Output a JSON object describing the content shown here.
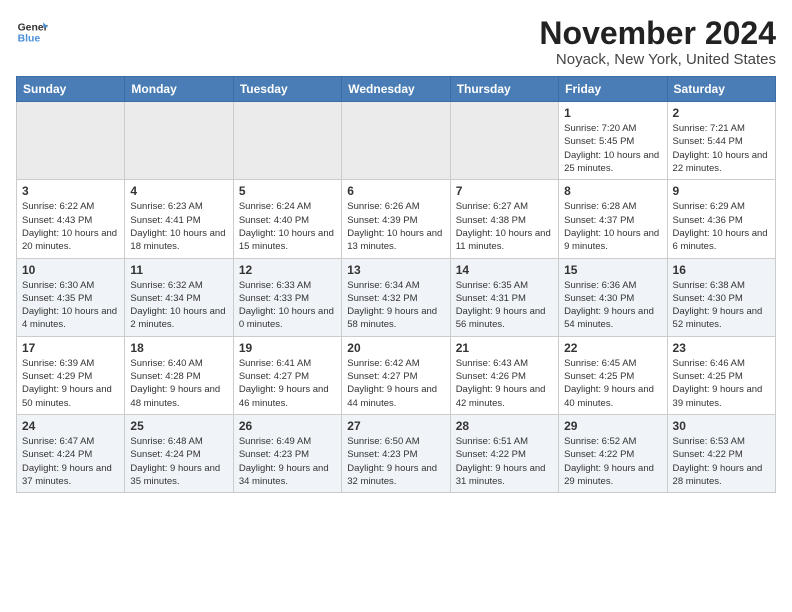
{
  "header": {
    "logo_line1": "General",
    "logo_line2": "Blue",
    "month_title": "November 2024",
    "location": "Noyack, New York, United States"
  },
  "days_of_week": [
    "Sunday",
    "Monday",
    "Tuesday",
    "Wednesday",
    "Thursday",
    "Friday",
    "Saturday"
  ],
  "weeks": [
    [
      {
        "empty": true
      },
      {
        "empty": true
      },
      {
        "empty": true
      },
      {
        "empty": true
      },
      {
        "empty": true
      },
      {
        "day": "1",
        "sunrise": "Sunrise: 7:20 AM",
        "sunset": "Sunset: 5:45 PM",
        "daylight": "Daylight: 10 hours and 25 minutes."
      },
      {
        "day": "2",
        "sunrise": "Sunrise: 7:21 AM",
        "sunset": "Sunset: 5:44 PM",
        "daylight": "Daylight: 10 hours and 22 minutes."
      }
    ],
    [
      {
        "day": "3",
        "sunrise": "Sunrise: 6:22 AM",
        "sunset": "Sunset: 4:43 PM",
        "daylight": "Daylight: 10 hours and 20 minutes."
      },
      {
        "day": "4",
        "sunrise": "Sunrise: 6:23 AM",
        "sunset": "Sunset: 4:41 PM",
        "daylight": "Daylight: 10 hours and 18 minutes."
      },
      {
        "day": "5",
        "sunrise": "Sunrise: 6:24 AM",
        "sunset": "Sunset: 4:40 PM",
        "daylight": "Daylight: 10 hours and 15 minutes."
      },
      {
        "day": "6",
        "sunrise": "Sunrise: 6:26 AM",
        "sunset": "Sunset: 4:39 PM",
        "daylight": "Daylight: 10 hours and 13 minutes."
      },
      {
        "day": "7",
        "sunrise": "Sunrise: 6:27 AM",
        "sunset": "Sunset: 4:38 PM",
        "daylight": "Daylight: 10 hours and 11 minutes."
      },
      {
        "day": "8",
        "sunrise": "Sunrise: 6:28 AM",
        "sunset": "Sunset: 4:37 PM",
        "daylight": "Daylight: 10 hours and 9 minutes."
      },
      {
        "day": "9",
        "sunrise": "Sunrise: 6:29 AM",
        "sunset": "Sunset: 4:36 PM",
        "daylight": "Daylight: 10 hours and 6 minutes."
      }
    ],
    [
      {
        "day": "10",
        "sunrise": "Sunrise: 6:30 AM",
        "sunset": "Sunset: 4:35 PM",
        "daylight": "Daylight: 10 hours and 4 minutes."
      },
      {
        "day": "11",
        "sunrise": "Sunrise: 6:32 AM",
        "sunset": "Sunset: 4:34 PM",
        "daylight": "Daylight: 10 hours and 2 minutes."
      },
      {
        "day": "12",
        "sunrise": "Sunrise: 6:33 AM",
        "sunset": "Sunset: 4:33 PM",
        "daylight": "Daylight: 10 hours and 0 minutes."
      },
      {
        "day": "13",
        "sunrise": "Sunrise: 6:34 AM",
        "sunset": "Sunset: 4:32 PM",
        "daylight": "Daylight: 9 hours and 58 minutes."
      },
      {
        "day": "14",
        "sunrise": "Sunrise: 6:35 AM",
        "sunset": "Sunset: 4:31 PM",
        "daylight": "Daylight: 9 hours and 56 minutes."
      },
      {
        "day": "15",
        "sunrise": "Sunrise: 6:36 AM",
        "sunset": "Sunset: 4:30 PM",
        "daylight": "Daylight: 9 hours and 54 minutes."
      },
      {
        "day": "16",
        "sunrise": "Sunrise: 6:38 AM",
        "sunset": "Sunset: 4:30 PM",
        "daylight": "Daylight: 9 hours and 52 minutes."
      }
    ],
    [
      {
        "day": "17",
        "sunrise": "Sunrise: 6:39 AM",
        "sunset": "Sunset: 4:29 PM",
        "daylight": "Daylight: 9 hours and 50 minutes."
      },
      {
        "day": "18",
        "sunrise": "Sunrise: 6:40 AM",
        "sunset": "Sunset: 4:28 PM",
        "daylight": "Daylight: 9 hours and 48 minutes."
      },
      {
        "day": "19",
        "sunrise": "Sunrise: 6:41 AM",
        "sunset": "Sunset: 4:27 PM",
        "daylight": "Daylight: 9 hours and 46 minutes."
      },
      {
        "day": "20",
        "sunrise": "Sunrise: 6:42 AM",
        "sunset": "Sunset: 4:27 PM",
        "daylight": "Daylight: 9 hours and 44 minutes."
      },
      {
        "day": "21",
        "sunrise": "Sunrise: 6:43 AM",
        "sunset": "Sunset: 4:26 PM",
        "daylight": "Daylight: 9 hours and 42 minutes."
      },
      {
        "day": "22",
        "sunrise": "Sunrise: 6:45 AM",
        "sunset": "Sunset: 4:25 PM",
        "daylight": "Daylight: 9 hours and 40 minutes."
      },
      {
        "day": "23",
        "sunrise": "Sunrise: 6:46 AM",
        "sunset": "Sunset: 4:25 PM",
        "daylight": "Daylight: 9 hours and 39 minutes."
      }
    ],
    [
      {
        "day": "24",
        "sunrise": "Sunrise: 6:47 AM",
        "sunset": "Sunset: 4:24 PM",
        "daylight": "Daylight: 9 hours and 37 minutes."
      },
      {
        "day": "25",
        "sunrise": "Sunrise: 6:48 AM",
        "sunset": "Sunset: 4:24 PM",
        "daylight": "Daylight: 9 hours and 35 minutes."
      },
      {
        "day": "26",
        "sunrise": "Sunrise: 6:49 AM",
        "sunset": "Sunset: 4:23 PM",
        "daylight": "Daylight: 9 hours and 34 minutes."
      },
      {
        "day": "27",
        "sunrise": "Sunrise: 6:50 AM",
        "sunset": "Sunset: 4:23 PM",
        "daylight": "Daylight: 9 hours and 32 minutes."
      },
      {
        "day": "28",
        "sunrise": "Sunrise: 6:51 AM",
        "sunset": "Sunset: 4:22 PM",
        "daylight": "Daylight: 9 hours and 31 minutes."
      },
      {
        "day": "29",
        "sunrise": "Sunrise: 6:52 AM",
        "sunset": "Sunset: 4:22 PM",
        "daylight": "Daylight: 9 hours and 29 minutes."
      },
      {
        "day": "30",
        "sunrise": "Sunrise: 6:53 AM",
        "sunset": "Sunset: 4:22 PM",
        "daylight": "Daylight: 9 hours and 28 minutes."
      }
    ]
  ]
}
